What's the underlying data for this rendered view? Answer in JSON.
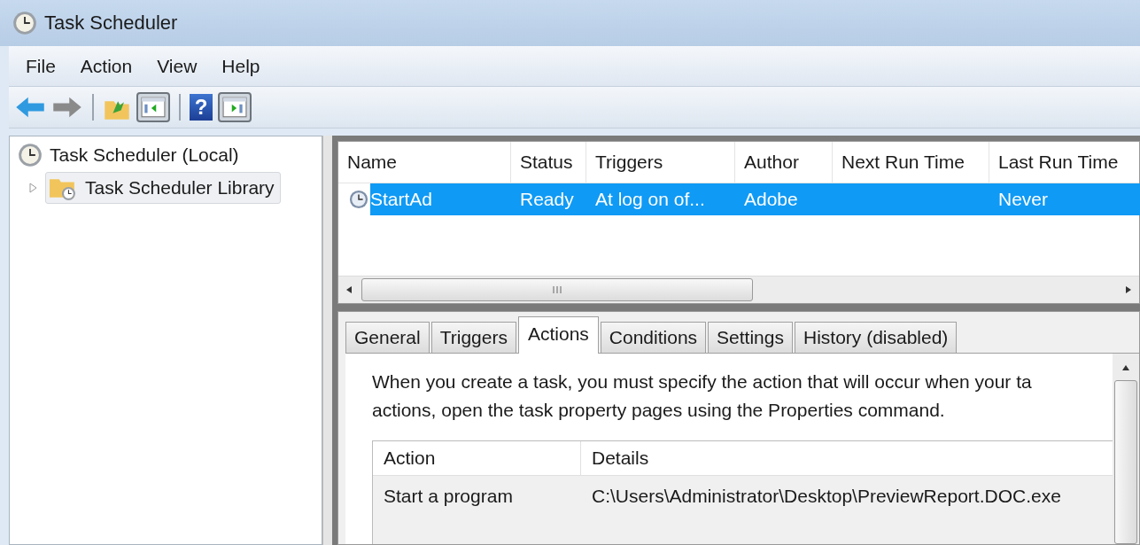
{
  "window": {
    "title": "Task Scheduler"
  },
  "menu": [
    "File",
    "Action",
    "View",
    "Help"
  ],
  "toolbar": [
    {
      "kind": "back",
      "disabled": false
    },
    {
      "kind": "forward",
      "disabled": true
    },
    {
      "kind": "separator"
    },
    {
      "kind": "up"
    },
    {
      "kind": "console-tree",
      "pressed": true
    },
    {
      "kind": "separator"
    },
    {
      "kind": "help",
      "glyph": "?"
    },
    {
      "kind": "action-pane",
      "pressed": true
    }
  ],
  "tree": [
    {
      "label": "Task Scheduler (Local)",
      "selected": false,
      "children": [
        {
          "label": "Task Scheduler Library",
          "selected": true,
          "expanded": false
        }
      ]
    }
  ],
  "task_list": {
    "columns": [
      "Name",
      "Status",
      "Triggers",
      "Author",
      "Next Run Time",
      "Last Run Time"
    ],
    "rows": [
      {
        "cells": [
          "StartAd",
          "Ready",
          "At log on of...",
          "Adobe",
          null,
          "Never"
        ],
        "selected": true
      }
    ]
  },
  "tabs": [
    {
      "label": "General",
      "selected": false
    },
    {
      "label": "Triggers",
      "selected": false
    },
    {
      "label": "Actions",
      "selected": true
    },
    {
      "label": "Conditions",
      "selected": false
    },
    {
      "label": "Settings",
      "selected": false
    },
    {
      "label": "History (disabled)",
      "selected": false
    }
  ],
  "actions_tab": {
    "description": [
      "When you create a task, you must specify the action that will occur when your ta",
      "actions, open the task property pages using the Properties command."
    ],
    "columns": [
      "Action",
      "Details"
    ],
    "rows": [
      [
        "Start a program",
        "C:\\Users\\Administrator\\Desktop\\PreviewReport.DOC.exe"
      ]
    ]
  }
}
